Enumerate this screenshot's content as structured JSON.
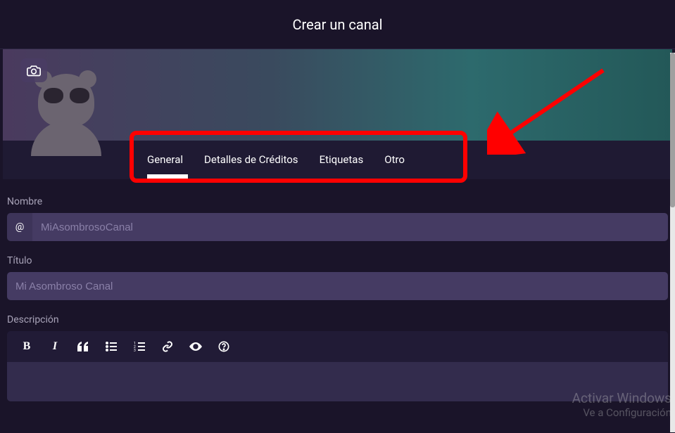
{
  "header": {
    "title": "Crear un canal"
  },
  "tabs": {
    "items": [
      {
        "label": "General",
        "active": true
      },
      {
        "label": "Detalles de Créditos",
        "active": false
      },
      {
        "label": "Etiquetas",
        "active": false
      },
      {
        "label": "Otro",
        "active": false
      }
    ]
  },
  "form": {
    "name": {
      "label": "Nombre",
      "prefix": "@",
      "placeholder": "MiAsombrosoCanal",
      "value": ""
    },
    "title": {
      "label": "Título",
      "placeholder": "Mi Asombroso Canal",
      "value": ""
    },
    "description": {
      "label": "Descripción"
    }
  },
  "editor": {
    "buttons": [
      "bold",
      "italic",
      "quote",
      "bullet-list",
      "ordered-list",
      "link",
      "preview",
      "help"
    ]
  },
  "watermark": {
    "title": "Activar Windows",
    "subtitle": "Ve a Configuración"
  },
  "icons": {
    "camera": "camera"
  }
}
